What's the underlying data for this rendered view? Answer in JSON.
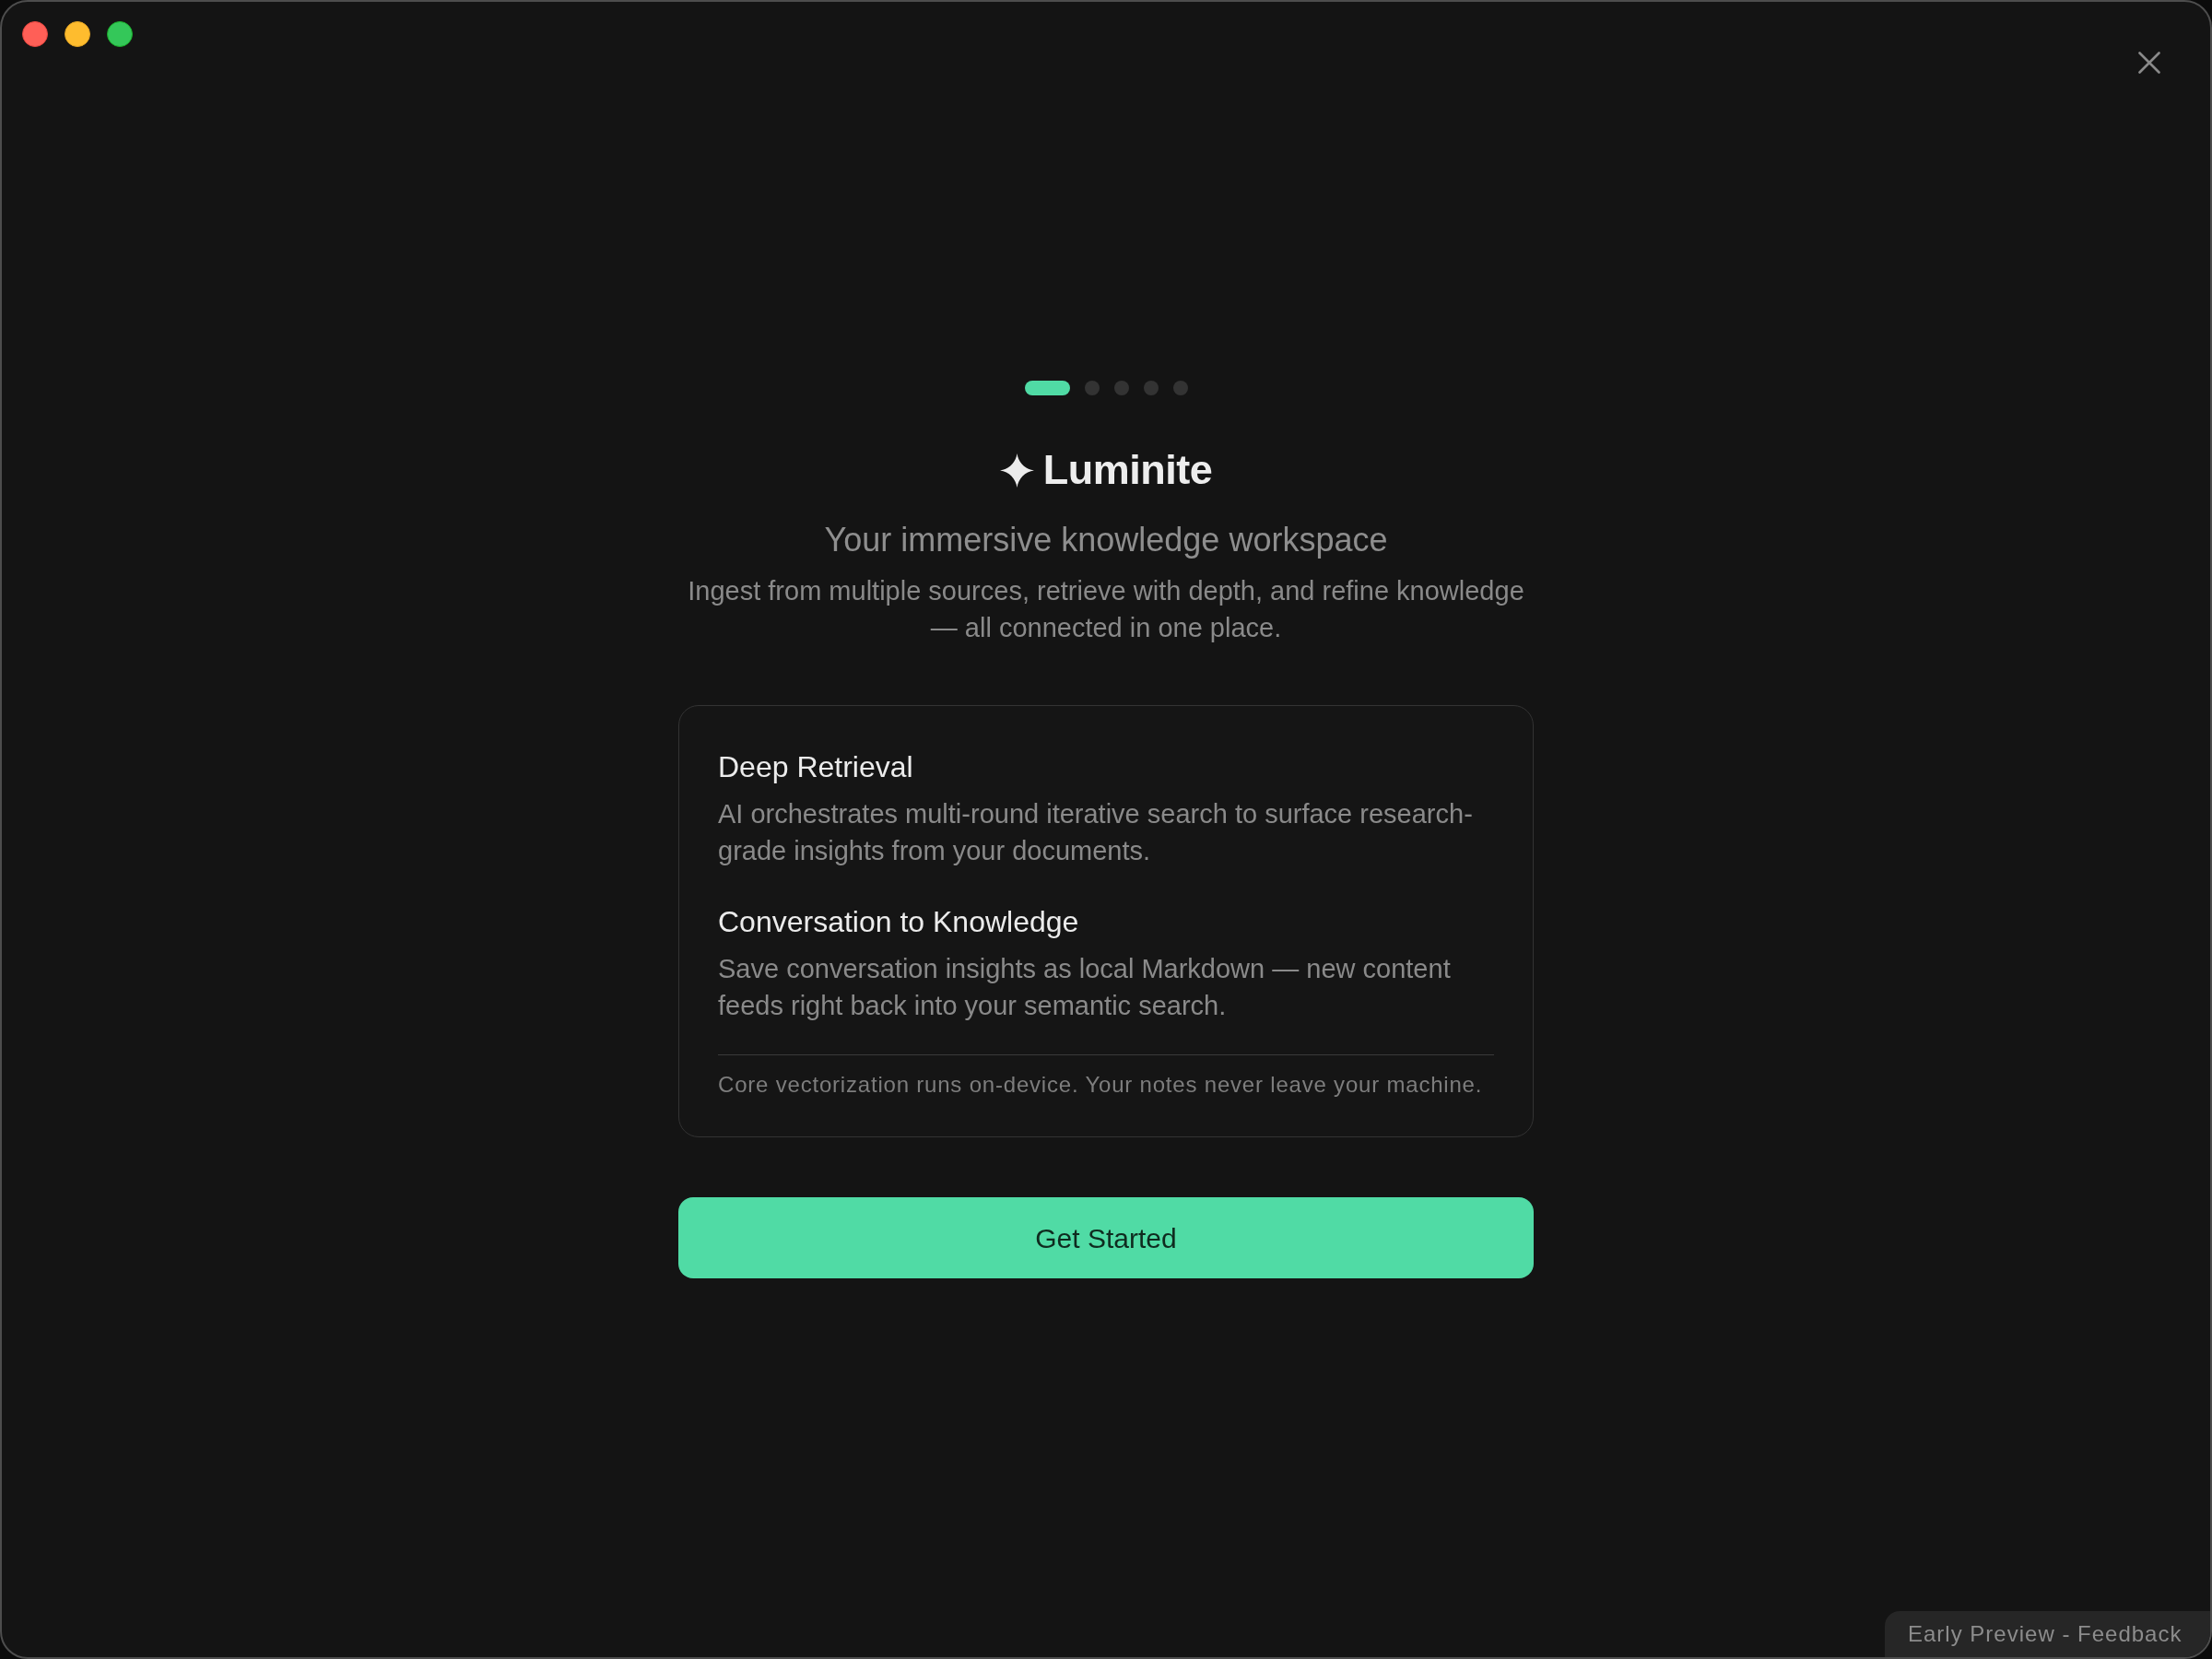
{
  "pager": {
    "steps": [
      {
        "selected": true
      },
      {
        "selected": false
      },
      {
        "selected": false
      },
      {
        "selected": false
      },
      {
        "selected": false
      }
    ]
  },
  "brand": {
    "name": "Luminite"
  },
  "tagline": "Your immersive knowledge workspace",
  "description": "Ingest from multiple sources, retrieve with depth, and refine knowledge — all connected in one place.",
  "features_card": {
    "features": [
      {
        "title": "Deep Retrieval",
        "description": "AI orchestrates multi-round iterative search to surface research-grade insights from your documents."
      },
      {
        "title": "Conversation to Knowledge",
        "description": "Save conversation insights as local Markdown — new content feeds right back into your semantic search."
      }
    ],
    "footnote": "Core vectorization runs on-device. Your notes never leave your machine."
  },
  "primary_button": {
    "label": "Get Started"
  },
  "feedback_badge": {
    "label": "Early Preview - Feedback"
  }
}
